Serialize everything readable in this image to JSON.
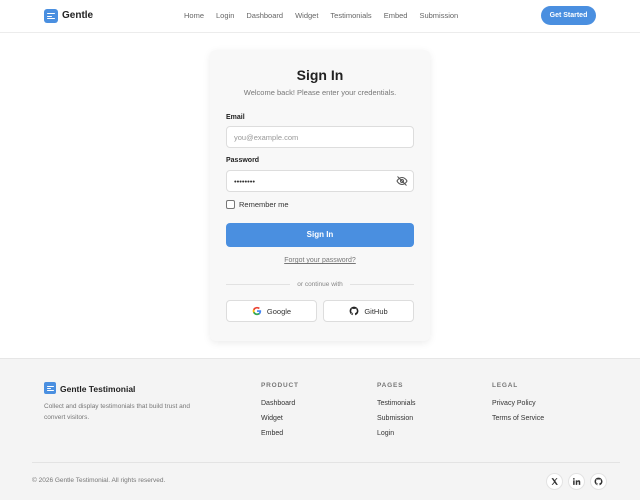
{
  "header": {
    "brand": "Gentle",
    "nav": [
      "Home",
      "Login",
      "Dashboard",
      "Widget",
      "Testimonials",
      "Embed",
      "Submission"
    ],
    "cta": "Get Started"
  },
  "signin": {
    "title": "Sign In",
    "subtitle": "Welcome back! Please enter your credentials.",
    "email_label": "Email",
    "email_placeholder": "you@example.com",
    "password_label": "Password",
    "password_value": "••••••••",
    "remember_label": "Remember me",
    "submit_label": "Sign In",
    "forgot_label": "Forgot your password?",
    "divider_text": "or continue with",
    "google_label": "Google",
    "github_label": "GitHub"
  },
  "footer": {
    "brand": "Gentle Testimonial",
    "description": "Collect and display testimonials that build trust and convert visitors.",
    "product": {
      "heading": "PRODUCT",
      "links": [
        "Dashboard",
        "Widget",
        "Embed"
      ]
    },
    "pages": {
      "heading": "PAGES",
      "links": [
        "Testimonials",
        "Submission",
        "Login"
      ]
    },
    "legal": {
      "heading": "LEGAL",
      "links": [
        "Privacy Policy",
        "Terms of Service"
      ]
    },
    "copyright": "© 2026 Gentle Testimonial. All rights reserved.",
    "social_icons": [
      "x-icon",
      "linkedin-icon",
      "github-icon"
    ]
  },
  "colors": {
    "accent": "#4a8fe0",
    "footer_bg": "#f4f4f4"
  }
}
